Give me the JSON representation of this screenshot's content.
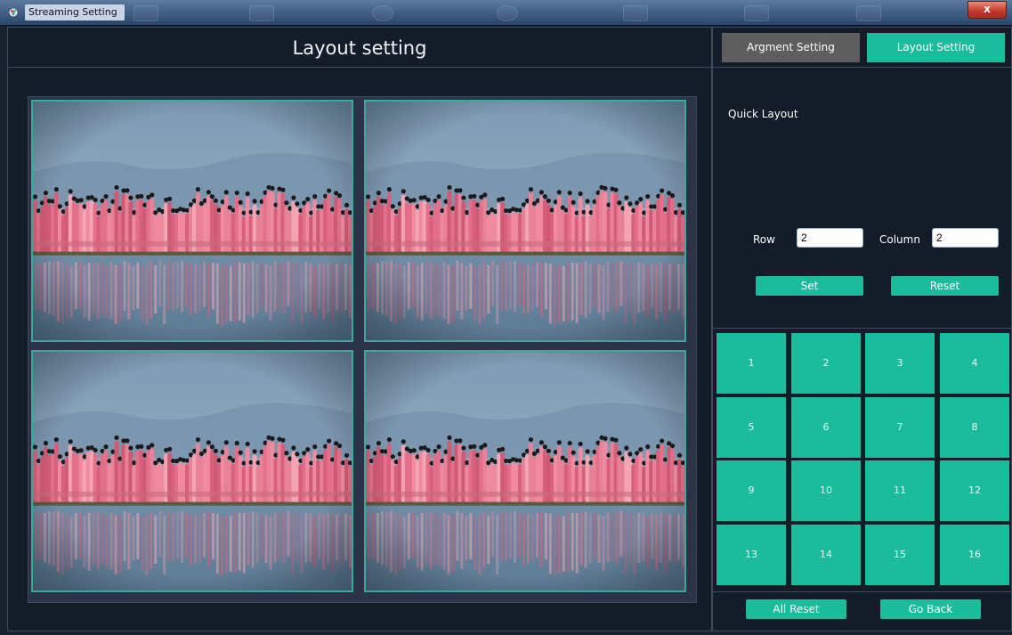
{
  "window": {
    "title": "Streaming Setting",
    "close_label": "x"
  },
  "main": {
    "header": "Layout setting",
    "preview": {
      "rows": 2,
      "columns": 2
    }
  },
  "tabs": [
    {
      "label": "Argment Setting",
      "active": false
    },
    {
      "label": "Layout Setting",
      "active": true
    }
  ],
  "quick_layout": {
    "label": "Quick Layout",
    "row_label": "Row",
    "row_value": "2",
    "column_label": "Column",
    "column_value": "2",
    "set_label": "Set",
    "reset_label": "Reset"
  },
  "presets": [
    "1",
    "2",
    "3",
    "4",
    "5",
    "6",
    "7",
    "8",
    "9",
    "10",
    "11",
    "12",
    "13",
    "14",
    "15",
    "16"
  ],
  "footer": {
    "all_reset_label": "All Reset",
    "go_back_label": "Go Back"
  },
  "colors": {
    "accent": "#1bbc9b",
    "inactive_tab": "#5e5e5e",
    "background": "#141c2a",
    "border": "#3d4b60"
  }
}
